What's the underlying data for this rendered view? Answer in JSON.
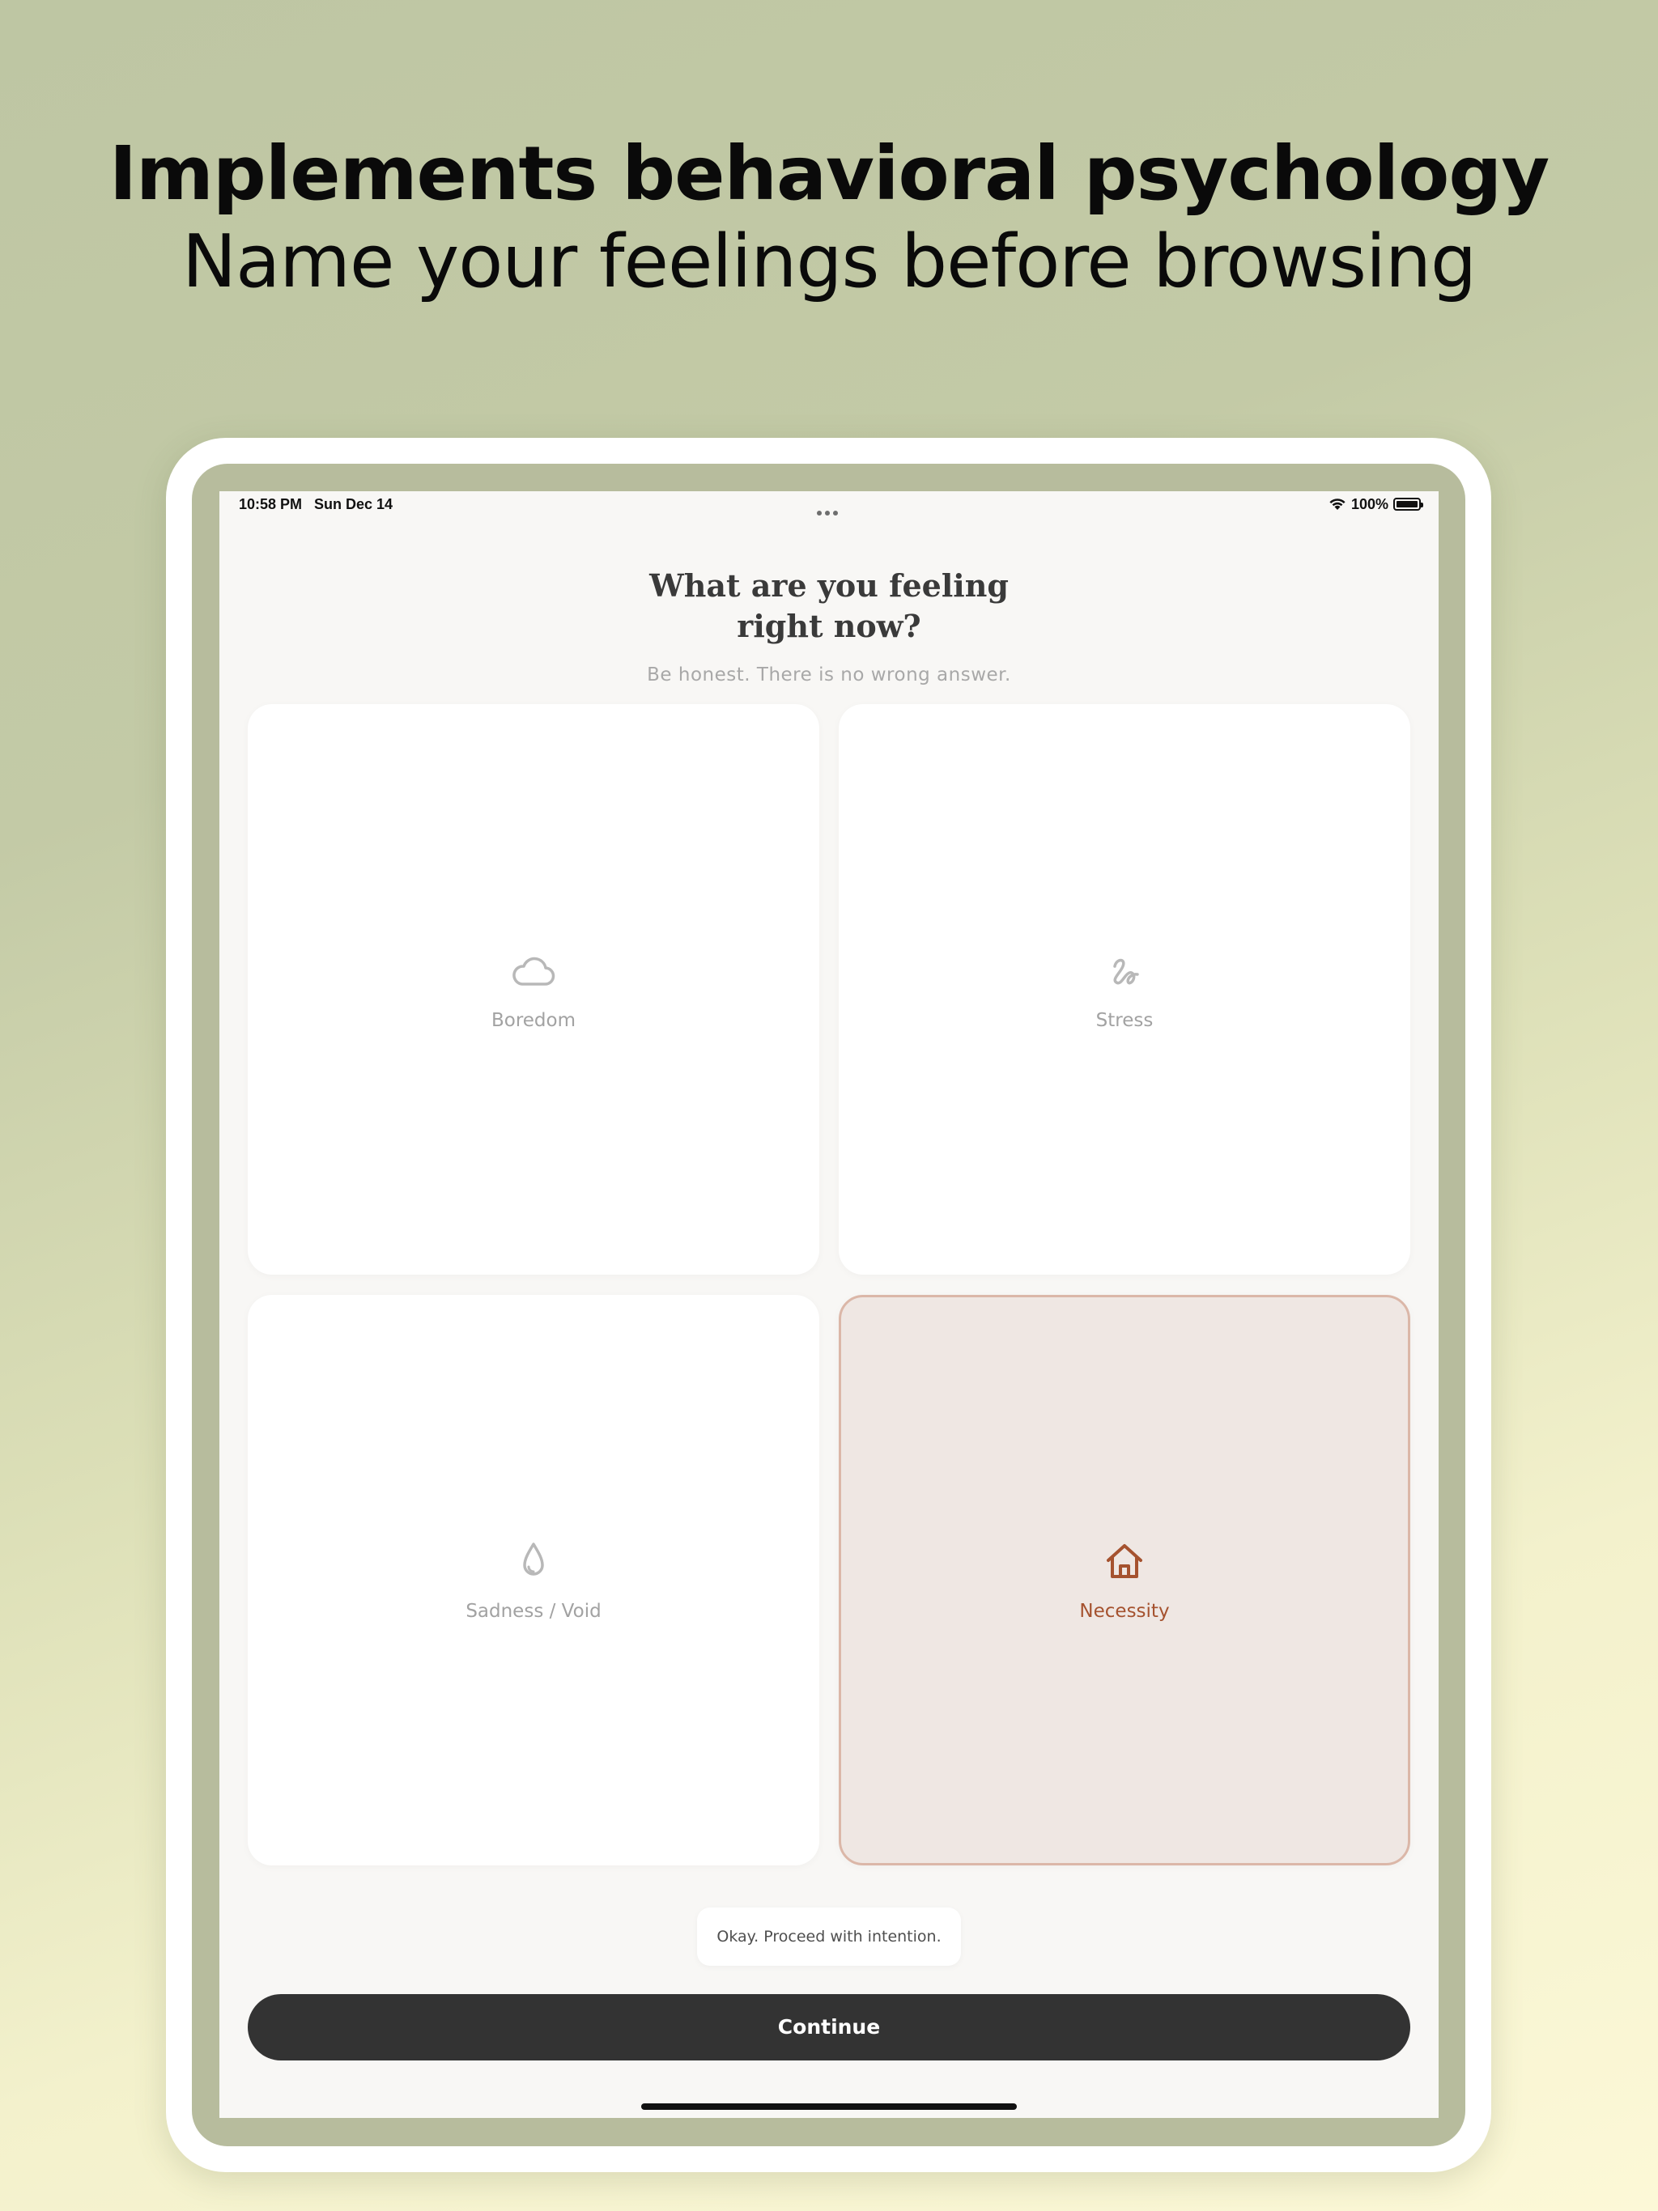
{
  "promo": {
    "headline": "Implements behavioral psychology",
    "subheadline": "Name your feelings before browsing"
  },
  "status_bar": {
    "time": "10:58 PM",
    "date": "Sun Dec 14",
    "battery": "100%",
    "battery_level": 1.0,
    "icons": [
      "wifi-icon",
      "battery-icon",
      "multitasking-dots-icon"
    ]
  },
  "question": {
    "title_line1": "What are you feeling",
    "title_line2": "right now?",
    "subtitle": "Be honest. There is no wrong answer."
  },
  "feelings": [
    {
      "label": "Boredom",
      "icon": "cloud-icon",
      "selected": false
    },
    {
      "label": "Stress",
      "icon": "squiggle-icon",
      "selected": false
    },
    {
      "label": "Sadness / Void",
      "icon": "droplet-icon",
      "selected": false
    },
    {
      "label": "Necessity",
      "icon": "home-icon",
      "selected": true
    }
  ],
  "toast": {
    "message": "Okay. Proceed with intention."
  },
  "actions": {
    "continue_label": "Continue"
  },
  "colors": {
    "selected_accent": "#a5522f",
    "selected_background": "#efe7e3",
    "selected_border": "#dbb7a8",
    "button_background": "#333333",
    "muted_icon": "#b5b5b5"
  }
}
